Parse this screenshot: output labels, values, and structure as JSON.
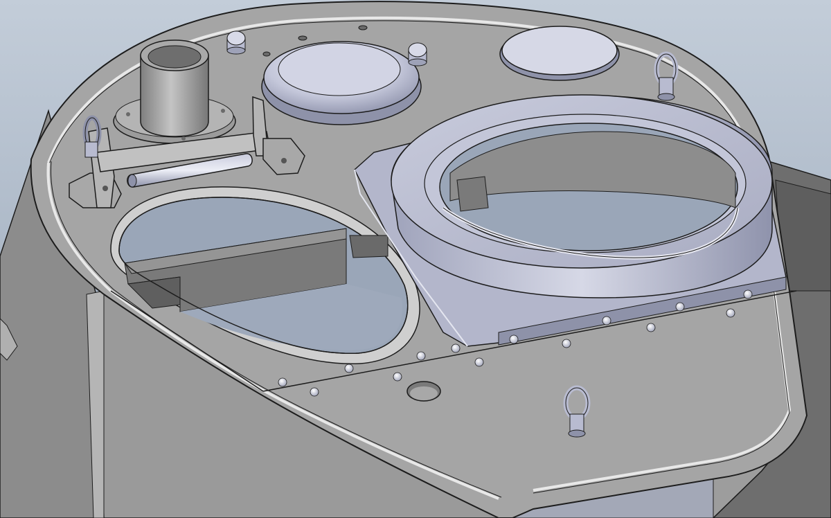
{
  "scene": {
    "colors": {
      "background_top": "#c3cdd9",
      "background_bottom": "#96a4b6",
      "body_light": "#a5a5a5",
      "body_mid": "#8c8c8c",
      "body_dark": "#6a6a6a",
      "edge_line": "#1c1c1c",
      "part_blue_light": "#dcdeec",
      "part_blue_mid": "#b8bbd0",
      "part_blue_dark": "#8a8ea8",
      "opening_interior": "#9aa6b8"
    },
    "parts": [
      "turret-body",
      "turret-roof",
      "commander-cupola-ring",
      "cupola-mounting-plate",
      "loader-hatch-opening",
      "periscope-tube",
      "periscope-mount",
      "ventilator-dome",
      "round-cover",
      "lifting-eye-front",
      "lifting-eye-left",
      "lifting-eye-right",
      "hinge-bracket",
      "hinge-pin",
      "rivets",
      "roof-hole"
    ]
  }
}
